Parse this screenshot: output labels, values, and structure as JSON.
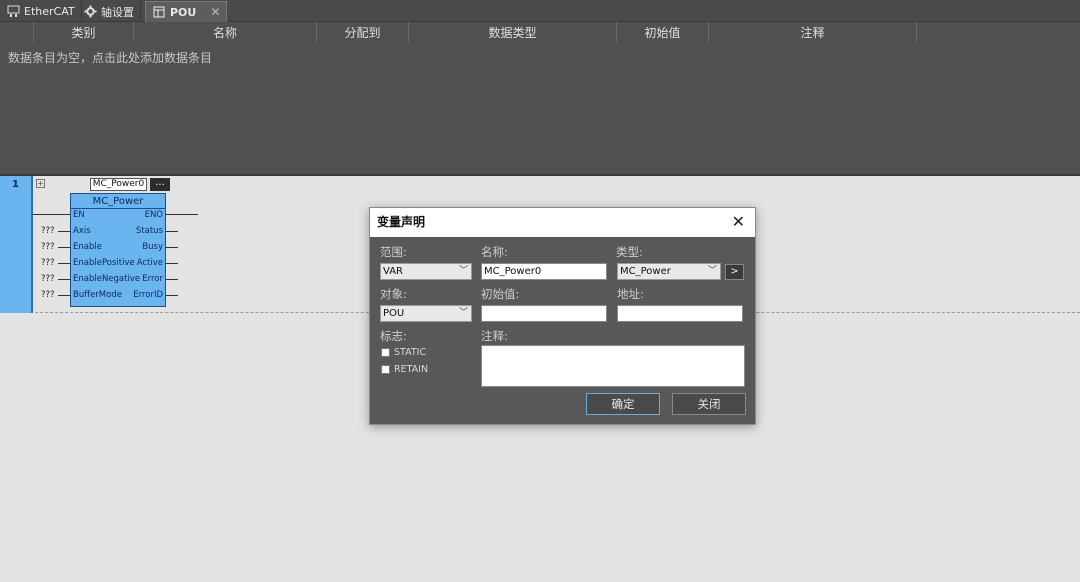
{
  "tabs": [
    {
      "label": "EtherCAT",
      "icon": "network-icon"
    },
    {
      "label": "轴设置",
      "icon": "gear-icon"
    },
    {
      "label": "POU",
      "icon": "pou-icon",
      "active": true,
      "close": "✕"
    }
  ],
  "var_table": {
    "columns": [
      "类别",
      "名称",
      "分配到",
      "数据类型",
      "初始值",
      "注释"
    ],
    "empty_hint": "数据条目为空，点击此处添加数据条目"
  },
  "ladder": {
    "rung_number": "1",
    "instance_name": "MC_Power0",
    "instance_button": "...",
    "block": {
      "title": "MC_Power",
      "inputs": [
        "EN",
        "Axis",
        "Enable",
        "EnablePositive",
        "EnableNegative",
        "BufferMode"
      ],
      "outputs": [
        "ENO",
        "Status",
        "Busy",
        "Active",
        "Error",
        "ErrorID"
      ],
      "unassigned": "???"
    }
  },
  "dialog": {
    "title": "变量声明",
    "close": "✕",
    "scope_label": "范围:",
    "scope_value": "VAR",
    "name_label": "名称:",
    "name_value": "MC_Power0",
    "type_label": "类型:",
    "type_value": "MC_Power",
    "type_button": ">",
    "object_label": "对象:",
    "object_value": "POU",
    "init_label": "初始值:",
    "init_value": "",
    "address_label": "地址:",
    "address_value": "",
    "flags_label": "标志:",
    "flags": [
      "STATIC",
      "RETAIN"
    ],
    "comment_label": "注释:",
    "ok_label": "确定",
    "close_label": "关闭"
  }
}
